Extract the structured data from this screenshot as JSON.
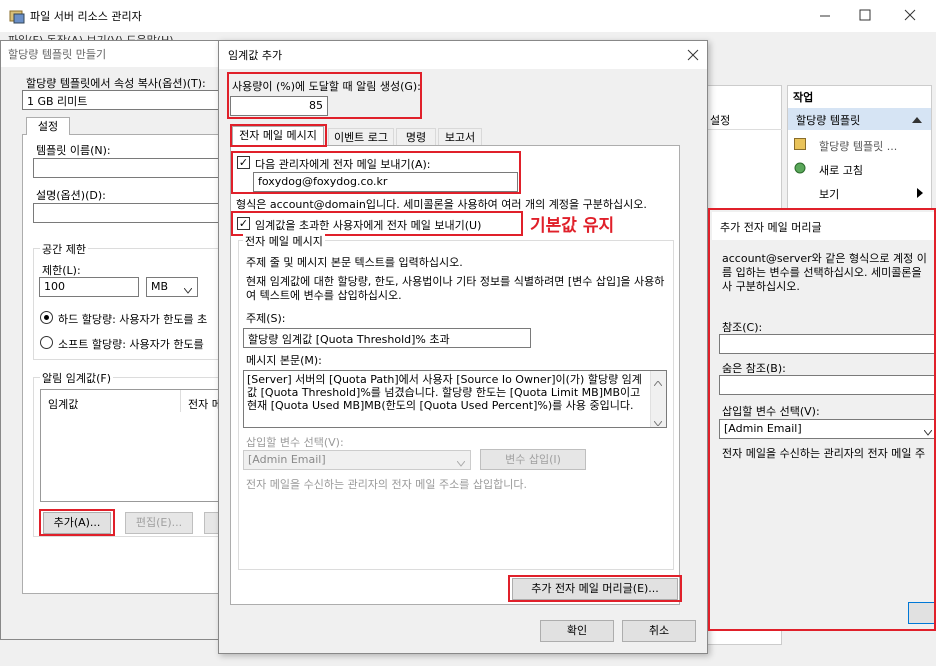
{
  "main_window": {
    "title": "파일 서버 리소스 관리자",
    "menu_partial": "파일(F)  동작(A)  보기(V)  도움말(H)"
  },
  "template_dialog": {
    "title": "할당량 템플릿 만들기",
    "copy_label": "할당량 템플릿에서 속성 복사(옵션)(T):",
    "copy_value": "1 GB 리미트",
    "tab_settings": "설정",
    "template_name_label": "템플릿 이름(N):",
    "description_label": "설명(옵션)(D):",
    "space_limit_label": "공간 제한",
    "limit_label": "제한(L):",
    "limit_value": "100",
    "limit_unit": "MB",
    "hard_quota": "하드 할당량: 사용자가 한도를 초",
    "soft_quota": "소프트 할당량: 사용자가 한도를",
    "thresholds_label": "알림 임계값(F)",
    "col_threshold": "임계값",
    "col_email": "전자 메",
    "add_button": "추가(A)...",
    "edit_button": "편집(E)..."
  },
  "right_panel": {
    "col_settings": "설정",
    "actions_header": "작업",
    "quota_templates": "할당량 템플릿",
    "item_template": "할당량 템플릿 ...",
    "item_refresh": "새로 고침",
    "item_view": "보기"
  },
  "threshold_dialog": {
    "title": "임계값 추가",
    "usage_label": "사용량이 (%)에 도달할 때 알림 생성(G):",
    "usage_value": "85",
    "tabs": [
      "전자 메일 메시지",
      "이벤트 로그",
      "명령",
      "보고서"
    ],
    "send_admin": "다음 관리자에게 전자 메일 보내기(A):",
    "admin_email": "foxydog@foxydog.co.kr",
    "format_hint": "형식은 account@domain입니다. 세미콜론을 사용하여 여러 개의 계정을 구분하십시오.",
    "send_user": "임계값을 초과한 사용자에게 전자 메일 보내기(U)",
    "annotation": "기본값 유지",
    "email_message_group": "전자 메일 메시지",
    "subject_hint": "주제 줄 및 메시지 본문 텍스트를 입력하십시오.",
    "insert_hint": "현재 임계값에 대한 할당량, 한도, 사용법이나 기타 정보를 식별하려면 [변수 삽입]을 사용하여 텍스트에 변수를 삽입하십시오.",
    "subject_label": "주제(S):",
    "subject_value": "할당량 임계값 [Quota Threshold]% 초과",
    "body_label": "메시지 본문(M):",
    "body_value": "[Server] 서버의 [Quota Path]에서 사용자 [Source Io Owner]이(가) 할당량 임계값 [Quota Threshold]%를 넘겼습니다. 할당량 한도는 [Quota Limit MB]MB이고 현재 [Quota Used MB]MB(한도의 [Quota Used Percent]%)를 사용 중입니다.",
    "var_label": "삽입할 변수 선택(V):",
    "var_value": "[Admin Email]",
    "insert_var_button": "변수 삽입(I)",
    "var_desc": "전자 메일을 수신하는 관리자의 전자 메일 주소를 삽입합니다.",
    "extra_headers_button": "추가 전자 메일 머리글(E)...",
    "ok_button": "확인",
    "cancel_button": "취소"
  },
  "headers_dialog": {
    "title": "추가 전자 메일 머리글",
    "desc": "account@server와 같은 형식으로 계정 이름 입하는 변수를 선택하십시오. 세미콜론을 사 구분하십시오.",
    "cc_label": "참조(C):",
    "bcc_label": "숨은 참조(B):",
    "var_label": "삽입할 변수 선택(V):",
    "var_value": "[Admin Email]",
    "var_desc": "전자 메일을 수신하는 관리자의 전자 메일 주"
  }
}
